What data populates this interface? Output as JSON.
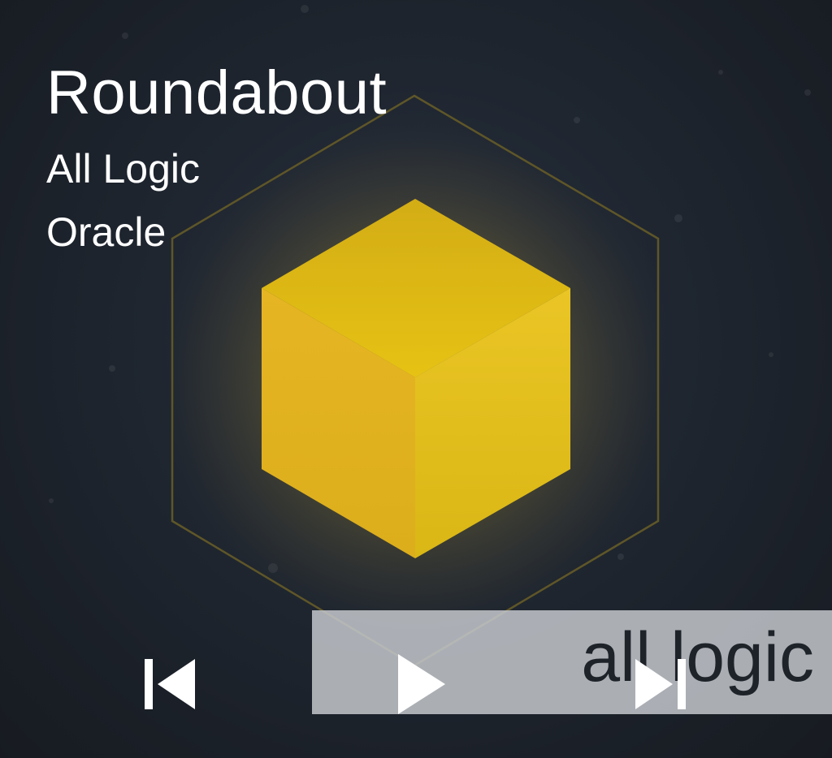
{
  "now_playing": {
    "title": "Roundabout",
    "artist": "All Logic",
    "album": "Oracle"
  },
  "artwork": {
    "label_text": "all logic",
    "cube_color": "#e8c21c",
    "glow_color": "#b89a20",
    "background_color": "#1b2027"
  },
  "controls": {
    "previous_icon": "skip-previous-icon",
    "play_icon": "play-icon",
    "next_icon": "skip-next-icon"
  }
}
